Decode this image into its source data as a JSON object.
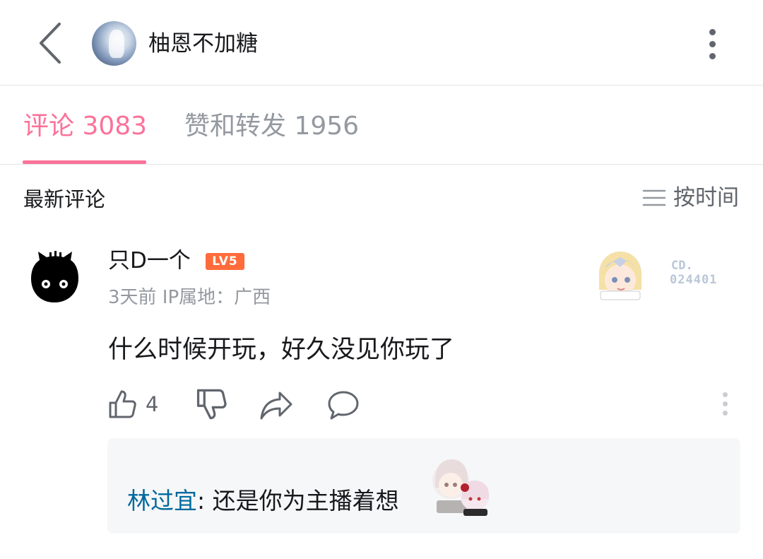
{
  "header": {
    "title": "柚恩不加糖",
    "back_icon": "chevron-left-icon",
    "more_icon": "more-vertical-icon"
  },
  "tabs": [
    {
      "label": "评论 3083",
      "active": true
    },
    {
      "label": "赞和转发 1956",
      "active": false
    }
  ],
  "sort": {
    "section_label": "最新评论",
    "toggle_label": "按时间",
    "icon": "list-sort-icon"
  },
  "comment": {
    "username": "只D一个",
    "level": "LV5",
    "meta": "3天前 IP属地：广西",
    "fan_badge_prefix": "CD.",
    "fan_badge_no": "024401",
    "content": "什么时候开玩，好久没见你玩了",
    "like_count": "4",
    "reply": {
      "user": "林过宜",
      "separator": ": ",
      "text": "还是你为主播着想"
    }
  },
  "colors": {
    "accent": "#fb7299",
    "reply_name": "#00699d",
    "level_badge": "#ff6b3b",
    "muted": "#9499a0"
  }
}
